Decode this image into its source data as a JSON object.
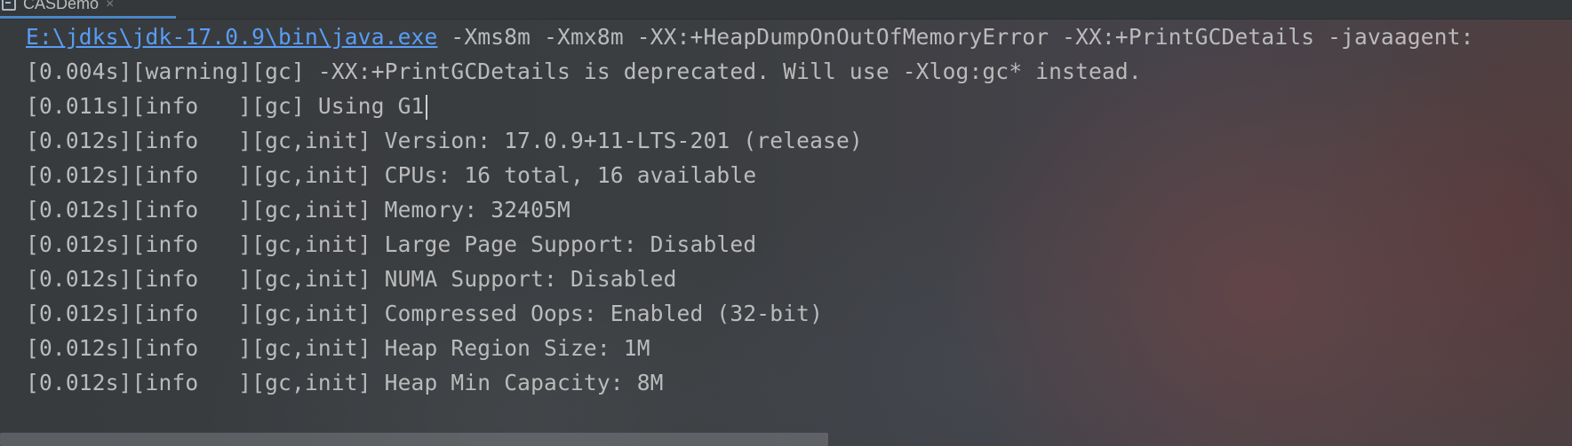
{
  "tab": {
    "title": "CASDemo",
    "close_glyph": "×",
    "icon": "application-icon"
  },
  "console": {
    "command": {
      "link": "E:\\jdks\\jdk-17.0.9\\bin\\java.exe",
      "args": " -Xms8m -Xmx8m -XX:+HeapDumpOnOutOfMemoryError -XX:+PrintGCDetails -javaagent:"
    },
    "lines": [
      "[0.004s][warning][gc] -XX:+PrintGCDetails is deprecated. Will use -Xlog:gc* instead.",
      "[0.011s][info   ][gc] Using G1",
      "[0.012s][info   ][gc,init] Version: 17.0.9+11-LTS-201 (release)",
      "[0.012s][info   ][gc,init] CPUs: 16 total, 16 available",
      "[0.012s][info   ][gc,init] Memory: 32405M",
      "[0.012s][info   ][gc,init] Large Page Support: Disabled",
      "[0.012s][info   ][gc,init] NUMA Support: Disabled",
      "[0.012s][info   ][gc,init] Compressed Oops: Enabled (32-bit)",
      "[0.012s][info   ][gc,init] Heap Region Size: 1M",
      "[0.012s][info   ][gc,init] Heap Min Capacity: 8M"
    ]
  },
  "colors": {
    "text": "#bbbbbb",
    "link": "#589df6",
    "tab_accent": "#4a88c7",
    "background": "#3a3d40"
  }
}
